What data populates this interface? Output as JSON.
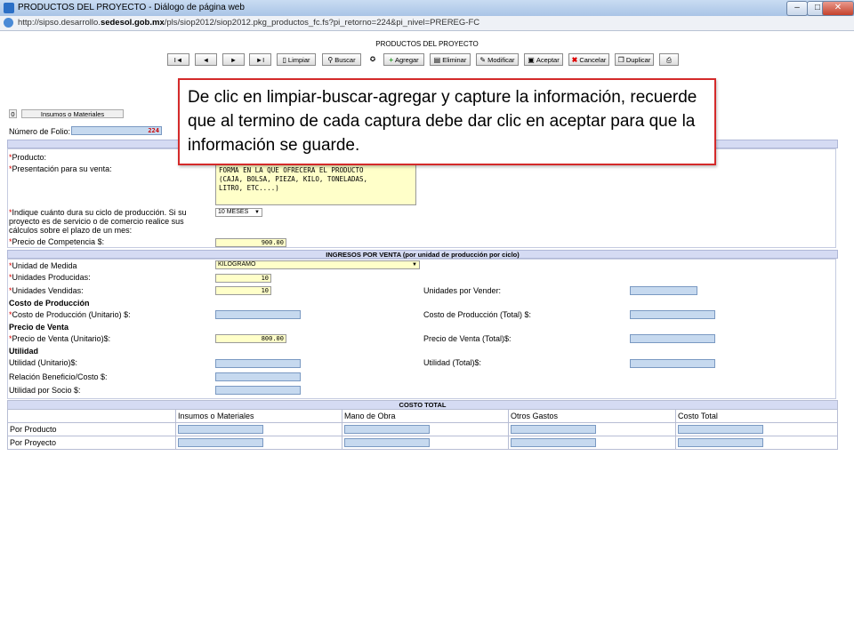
{
  "window": {
    "title": "PRODUCTOS DEL PROYECTO - Diálogo de página web",
    "url_prefix": "http://sipso.desarrollo.",
    "url_domain": "sedesol.gob.mx",
    "url_suffix": "/pls/siop2012/siop2012.pkg_productos_fc.fs?pi_retorno=224&pi_nivel=PREREG-FC",
    "btn_min": "–",
    "btn_max": "□",
    "btn_close": "✕"
  },
  "page_title": "PRODUCTOS DEL PROYECTO",
  "toolbar": {
    "first": "I◄",
    "prev": "◄",
    "next": "►",
    "last": "►I",
    "limpiar": "Limpiar",
    "buscar": "Buscar",
    "agregar": "Agregar",
    "eliminar": "Eliminar",
    "modificar": "Modificar",
    "aceptar": "Aceptar",
    "cancelar": "Cancelar",
    "duplicar": "Duplicar"
  },
  "callout": "De clic en limpiar-buscar-agregar y capture la información, recuerde que al termino de cada captura debe dar clic en aceptar para que la información se guarde.",
  "insumos_button": "Insumos o Materiales",
  "folio": {
    "label": "Número de Folio:",
    "value": "224"
  },
  "form": {
    "producto": "Producto:",
    "presentacion": "Presentación para su venta:",
    "presentacion_value": "FORMA EN LA QUE OFRECERA EL PRODUCTO\n(CAJA, BOLSA, PIEZA, KILO, TONELADAS,\nLITRO, ETC....)",
    "ciclo_line1": "Indique cuánto dura su ciclo de producción. Si su",
    "ciclo_line2": "proyecto es de servicio o de comercio realice sus",
    "ciclo_line3": "cálculos sobre el plazo de un mes:",
    "ciclo_value": "10 MESES",
    "precio_competencia": "Precio de Competencia $:",
    "precio_competencia_value": "900.00"
  },
  "ingresos": {
    "header": "INGRESOS POR VENTA (por unidad de producción por ciclo)",
    "unidad_medida": "Unidad de Medida",
    "unidad_medida_value": "KILOGRAMO",
    "unidades_producidas": "Unidades Producidas:",
    "unidades_producidas_value": "10",
    "unidades_vendidas": "Unidades Vendidas:",
    "unidades_vendidas_value": "10",
    "unidades_por_vender": "Unidades por Vender:",
    "costo_produccion_title": "Costo de Producción",
    "costo_unitario": "Costo de Producción (Unitario) $:",
    "costo_total": "Costo de Producción (Total) $:",
    "precio_venta_title": "Precio de Venta",
    "precio_venta_unitario": "Precio de Venta (Unitario)$:",
    "precio_venta_unitario_value": "800.00",
    "precio_venta_total": "Precio de Venta (Total)$:",
    "utilidad_title": "Utilidad",
    "utilidad_unitario": "Utilidad (Unitario)$:",
    "utilidad_total": "Utilidad (Total)$:",
    "relacion": "Relación Beneficio/Costo $:",
    "utilidad_socio": "Utilidad por Socio $:"
  },
  "costo_total": {
    "header": "COSTO TOTAL",
    "columns": [
      "Insumos o Materiales",
      "Mano de Obra",
      "Otros Gastos",
      "Costo Total"
    ],
    "rows": [
      "Por Producto",
      "Por Proyecto"
    ]
  }
}
